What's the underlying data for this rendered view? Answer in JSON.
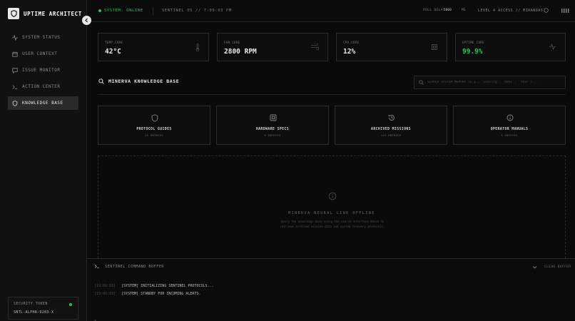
{
  "app": {
    "title": "UPTIME ARCHITECT"
  },
  "sidebar": {
    "items": [
      {
        "label": "SYSTEM STATUS",
        "icon": "activity-icon"
      },
      {
        "label": "USER CONTEXT",
        "icon": "calendar-icon"
      },
      {
        "label": "ISSUE MONITOR",
        "icon": "message-icon"
      },
      {
        "label": "ACTION CENTER",
        "icon": "terminal-icon"
      },
      {
        "label": "KNOWLEDGE BASE",
        "icon": "shield-icon",
        "active": true
      }
    ],
    "token": {
      "label": "SECURITY TOKEN",
      "value": "SNTL-ALPHA-9283-X"
    }
  },
  "topbar": {
    "status": "SYSTEM: ONLINE",
    "sentinel": "SENTINEL OS // 7:09:03 PM",
    "poll_label": "POLL DELAY:",
    "poll_value": "5000",
    "poll_unit": "MS",
    "access": "LEVEL 4 ACCESS // MIRANDAS"
  },
  "stats": [
    {
      "label": "TEMP_CORE",
      "value": "42°C",
      "icon": "thermometer-icon"
    },
    {
      "label": "FAN_CORE",
      "value": "2800 RPM",
      "icon": "wind-icon"
    },
    {
      "label": "CPU_CORE",
      "value": "12%",
      "icon": "cpu-icon"
    },
    {
      "label": "UPTIME_CORE",
      "value": "99.9%",
      "icon": "activity-icon"
    }
  ],
  "kb": {
    "title": "MINERVA KNOWLEDGE BASE",
    "search_placeholder": "SEARCH SYSTEM MEMORY (e.g., 'cooling', 'HVAC', 'fans')...",
    "categories": [
      {
        "title": "PROTOCOL GUIDES",
        "sub": "12 ENTRIES",
        "icon": "shield-icon"
      },
      {
        "title": "HARDWARE SPECS",
        "sub": "8 ENTRIES",
        "icon": "cpu-icon"
      },
      {
        "title": "ARCHIVED MISSIONS",
        "sub": "143 ENTRIES",
        "icon": "history-icon"
      },
      {
        "title": "OPERATOR MANUALS",
        "sub": "5 ENTRIES",
        "icon": "info-icon"
      }
    ],
    "offline_title": "MINERVA NEURAL LINK OFFLINE",
    "offline_desc": "Query the knowledge base using the search interface above to retrieve archived mission data and system recovery protocols."
  },
  "console": {
    "title": "SENTINEL COMMAND BUFFER",
    "clear": "CLEAR BUFFER",
    "logs": [
      {
        "time": "[19:09:03]",
        "text": "[SYSTEM] INITIALIZING SENTINEL PROTOCOLS..."
      },
      {
        "time": "[19:09:03]",
        "text": "[SYSTEM] STANDBY FOR INCOMING ALERTS."
      }
    ],
    "prompt": ">_"
  },
  "colors": {
    "accent": "#22c55e",
    "bg": "#0a0a0a",
    "panel": "#111111",
    "border": "#2a2a2a"
  }
}
